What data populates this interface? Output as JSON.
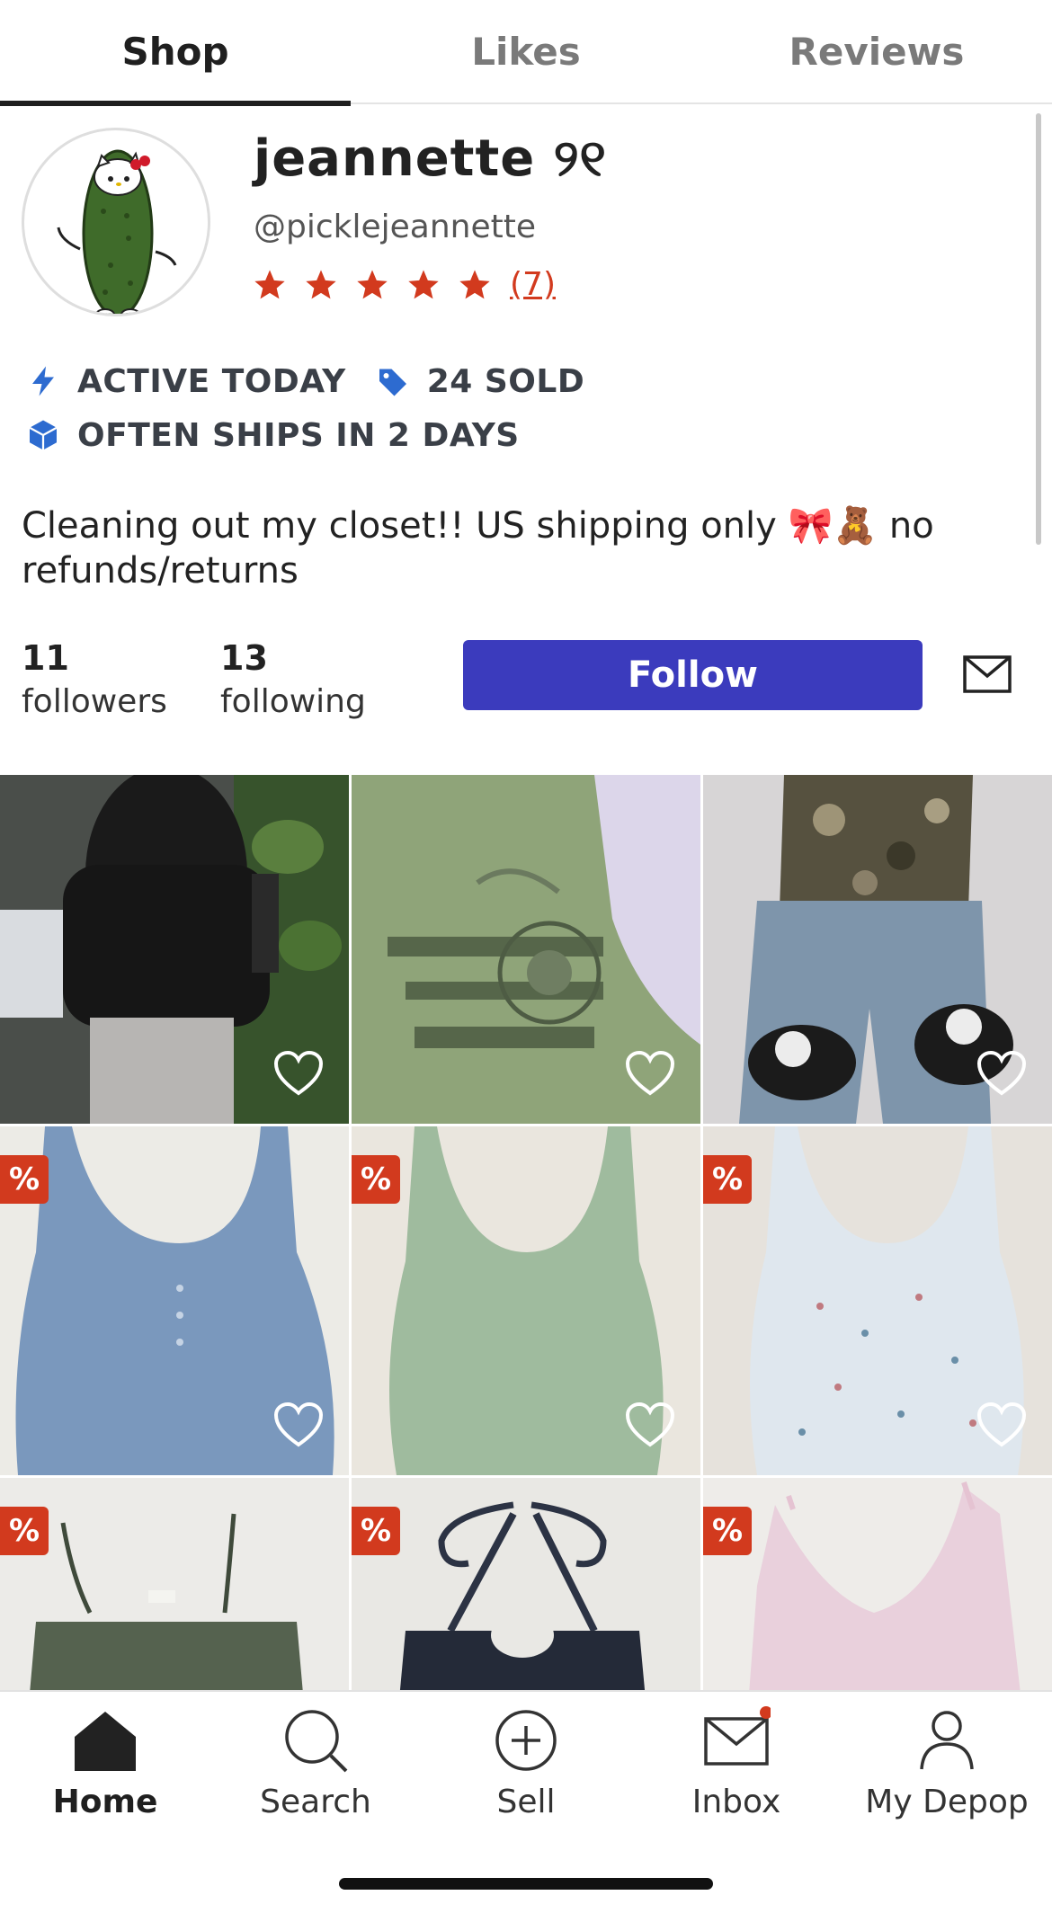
{
  "tabs": [
    {
      "label": "Shop",
      "active": true
    },
    {
      "label": "Likes",
      "active": false
    },
    {
      "label": "Reviews",
      "active": false
    }
  ],
  "profile": {
    "display_name": "jeannette ୨୧",
    "handle": "@picklejeannette",
    "rating_stars": 5,
    "review_count": "(7)",
    "avatar_icon": "pickle-hello-kitty-avatar"
  },
  "badges": {
    "active": {
      "label": "ACTIVE TODAY",
      "icon": "lightning-icon"
    },
    "sold": {
      "label": "24 SOLD",
      "icon": "tag-icon"
    },
    "shipping": {
      "label": "OFTEN SHIPS IN 2 DAYS",
      "icon": "box-icon"
    }
  },
  "bio": "Cleaning out my closet!! US shipping only 🎀🧸 no refunds/returns",
  "stats": {
    "followers": {
      "count": "11",
      "label": "followers"
    },
    "following": {
      "count": "13",
      "label": "following"
    }
  },
  "actions": {
    "follow_label": "Follow",
    "message_icon": "envelope-icon"
  },
  "listings": [
    {
      "id": 1,
      "desc": "black puffer jacket photo",
      "discount": false
    },
    {
      "id": 2,
      "desc": "green graphic tee",
      "discount": false
    },
    {
      "id": 3,
      "desc": "camo top, jeans and sneakers",
      "discount": false
    },
    {
      "id": 4,
      "desc": "blue lace cami",
      "discount": true
    },
    {
      "id": 5,
      "desc": "green lace cami",
      "discount": true
    },
    {
      "id": 6,
      "desc": "floral lace cami",
      "discount": true
    },
    {
      "id": 7,
      "desc": "olive cami",
      "discount": true
    },
    {
      "id": 8,
      "desc": "navy halter top",
      "discount": true
    },
    {
      "id": 9,
      "desc": "pink halter top",
      "discount": true
    }
  ],
  "discount_badge": "%",
  "nav": [
    {
      "label": "Home",
      "icon": "home-icon",
      "active": true
    },
    {
      "label": "Search",
      "icon": "search-icon",
      "active": false
    },
    {
      "label": "Sell",
      "icon": "plus-circle-icon",
      "active": false
    },
    {
      "label": "Inbox",
      "icon": "envelope-icon",
      "active": false,
      "notification_dot": true
    },
    {
      "label": "My Depop",
      "icon": "person-icon",
      "active": false
    }
  ],
  "colors": {
    "accent": "#3b3bbd",
    "rating": "#d23a1e",
    "badge_blue": "#2d6bd0",
    "text_dark": "#222222"
  }
}
